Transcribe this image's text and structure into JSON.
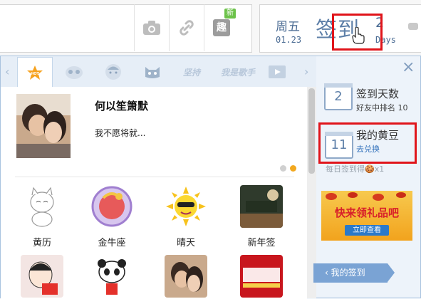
{
  "toolbar": {
    "new_badge": "新",
    "interest_icon_glyph": "趣",
    "icons": [
      "camera-icon",
      "link-icon",
      "interest-icon"
    ]
  },
  "checkin": {
    "weekday": "周五",
    "date": "01.23",
    "button_label": "签到",
    "days_count": "2",
    "days_label": "Days"
  },
  "tabs": [
    {
      "name": "hot",
      "label": "HOT"
    },
    {
      "name": "panda"
    },
    {
      "name": "face"
    },
    {
      "name": "cat"
    },
    {
      "name": "persist",
      "label": "坚持"
    },
    {
      "name": "singer",
      "label": "我是歌手"
    },
    {
      "name": "video"
    }
  ],
  "feature": {
    "title": "何以笙箫默",
    "description": "我不愿将就..."
  },
  "grid": [
    {
      "label": "黄历"
    },
    {
      "label": "金牛座"
    },
    {
      "label": "晴天"
    },
    {
      "label": "新年签"
    },
    {
      "label": ""
    },
    {
      "label": ""
    },
    {
      "label": ""
    },
    {
      "label": ""
    }
  ],
  "sidebar": {
    "close_label": "×",
    "streak": {
      "number": "2",
      "title": "签到天数",
      "subtitle": "好友中排名 10"
    },
    "beans": {
      "number": "11",
      "title": "我的黄豆",
      "link": "去兑换"
    },
    "note": "每日签到得🍪x1",
    "ad": {
      "text": "快来领礼品吧",
      "button": "立即查看"
    },
    "my_checkin": "我的签到"
  },
  "colors": {
    "accent": "#5d7fa8",
    "highlight": "#e0141a",
    "link": "#2f6fba"
  }
}
